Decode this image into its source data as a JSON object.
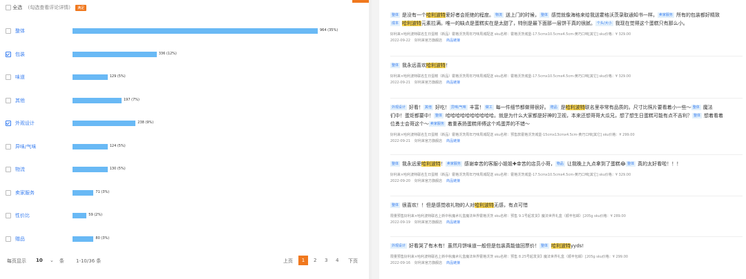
{
  "left": {
    "header": {
      "all_label": "全选",
      "hint": "(勾选查看评论详情)",
      "badge": "满足"
    },
    "rows": [
      {
        "label": "整体",
        "count_label": "964 (35%)",
        "share": 0.35,
        "checked": false
      },
      {
        "label": "包装",
        "count_label": "336 (12%)",
        "share": 0.12,
        "checked": true
      },
      {
        "label": "味道",
        "count_label": "129 (5%)",
        "share": 0.05,
        "checked": false
      },
      {
        "label": "其他",
        "count_label": "197 (7%)",
        "share": 0.07,
        "checked": false
      },
      {
        "label": "外观设计",
        "count_label": "238 (9%)",
        "share": 0.09,
        "checked": true
      },
      {
        "label": "异味/气味",
        "count_label": "124 (5%)",
        "share": 0.05,
        "checked": false
      },
      {
        "label": "物流",
        "count_label": "130 (5%)",
        "share": 0.05,
        "checked": false
      },
      {
        "label": "卖家服务",
        "count_label": "71 (3%)",
        "share": 0.03,
        "checked": false
      },
      {
        "label": "性价比",
        "count_label": "59 (2%)",
        "share": 0.02,
        "checked": false
      },
      {
        "label": "赠品",
        "count_label": "80 (3%)",
        "share": 0.03,
        "checked": false
      }
    ],
    "pager": {
      "per_page_label": "每页显示",
      "per_page": "10",
      "unit": "条",
      "range": "1-10/36 条",
      "prev": "上页",
      "pages": [
        "1",
        "2",
        "3",
        "4"
      ],
      "next": "下页"
    }
  },
  "reviews": [
    {
      "lines": [
        [
          {
            "t": "tag",
            "v": "整体"
          },
          {
            "t": "x",
            "v": "是没有一个"
          },
          {
            "t": "hl",
            "v": "哈利波特"
          },
          {
            "t": "x",
            "v": "爱好者会拒绝的程度。"
          },
          {
            "t": "tag",
            "v": "物流"
          },
          {
            "t": "x",
            "v": "送上门的时候，"
          },
          {
            "t": "tag",
            "v": "整体"
          },
          {
            "t": "x",
            "v": "感觉就像海格来给我送霍格沃茨录取通知书一样。"
          },
          {
            "t": "tag",
            "v": "卖家服务"
          },
          {
            "t": "x",
            "v": "所有的包装都好精致"
          }
        ],
        [
          {
            "t": "tag",
            "v": "成本"
          },
          {
            "t": "hl",
            "v": "哈利波特"
          },
          {
            "t": "x",
            "v": "元素拉满。唯一的缺点是蛋糕实在是太甜了，特别是最下面那一层饼干真的很腻。"
          },
          {
            "t": "tag",
            "v": "个头/大小"
          },
          {
            "t": "x",
            "v": "我现在觉得这个蛋糕只有那么小。"
          }
        ]
      ],
      "meta1": "好利来×哈利波特联名生日蛋糕（新品）霍格沃茨周年巧味周城配送   sku名称：霍格沃茨城堡-17.5cmx10.5cmx4.5cm-黄巧口味[其它]   sku价格：¥ 329.00",
      "date": "2022-09-22",
      "shop": "好利来官方旗舰店",
      "link": "商品链接"
    },
    {
      "lines": [
        [
          {
            "t": "tag",
            "v": "整体"
          },
          {
            "t": "x",
            "v": "我永远喜欢"
          },
          {
            "t": "hl",
            "v": "哈利波特"
          },
          {
            "t": "x",
            "v": "！"
          }
        ]
      ],
      "meta1": "好利来×哈利波特联名生日蛋糕（新品）霍格沃茨周年巧味周城配送   sku名称：霍格沃茨城堡-17.5cmx10.5cmx4.5cm-黄巧口味[其它]   sku价格：¥ 329.00",
      "date": "2022-09-21",
      "shop": "好利来官方旗舰店",
      "link": "商品链接"
    },
    {
      "lines": [
        [
          {
            "t": "tag",
            "v": "外观设计"
          },
          {
            "t": "x",
            "v": "好看！"
          },
          {
            "t": "tag",
            "v": "其他"
          },
          {
            "t": "x",
            "v": "好吃！"
          },
          {
            "t": "tag",
            "v": "异味/气味"
          },
          {
            "t": "x",
            "v": "丰富！"
          },
          {
            "t": "tag",
            "v": "做工"
          },
          {
            "t": "x",
            "v": "每一件细节都做得很好。"
          },
          {
            "t": "tag",
            "v": "赠品"
          },
          {
            "t": "x",
            "v": "是"
          },
          {
            "t": "hl",
            "v": "哈利波特"
          },
          {
            "t": "x",
            "v": "联名里非常有品质的。尺寸比照片要看着小一些～"
          },
          {
            "t": "tag",
            "v": "整体"
          },
          {
            "t": "x",
            "v": "魔法"
          }
        ],
        [
          {
            "t": "x",
            "v": "们中！蛋炬都要中！"
          },
          {
            "t": "tag",
            "v": "整体"
          },
          {
            "t": "x",
            "v": "哈哈哈哈哈哈哈哈哈哈。就是为什么大家都是好神的卫视，本来还想哥哥大瓜兄，想了想生日蛋糕可能有点不吉利？"
          },
          {
            "t": "tag",
            "v": "整体"
          },
          {
            "t": "x",
            "v": "想着看着"
          }
        ],
        [
          {
            "t": "x",
            "v": "位勇士会哥这个～"
          },
          {
            "t": "tag",
            "v": "卖家服务"
          },
          {
            "t": "x",
            "v": "着重表扬蛋糕师傅这个鸡蛋弄的不错～"
          }
        ]
      ],
      "meta1": "好利来×哈利波特联名生日蛋糕（新品）霍格沃茨周年巧味周城配送   sku名称：预售款霍格沃茨城堡-15cmx13cmx4.5cm-黄巧口味[其它]   sku价格：¥ 299.00",
      "date": "2022-09-21",
      "shop": "好利来官方旗舰店",
      "link": "商品链接"
    },
    {
      "lines": [
        [
          {
            "t": "tag",
            "v": "整体"
          },
          {
            "t": "x",
            "v": "我永远爱"
          },
          {
            "t": "hl",
            "v": "哈利波特"
          },
          {
            "t": "x",
            "v": "！"
          },
          {
            "t": "tag",
            "v": "卖家服务"
          },
          {
            "t": "x",
            "v": "感谢幸苦的客服小姐姐✚幸苦的店员小哥，"
          },
          {
            "t": "tag",
            "v": "物品"
          },
          {
            "t": "x",
            "v": "让我晚上九点拿到了蛋糕😂"
          },
          {
            "t": "tag",
            "v": "整体"
          },
          {
            "t": "x",
            "v": "真的太好看啦！！！"
          }
        ]
      ],
      "meta1": "好利来×哈利波特联名生日蛋糕（新品）霍格沃茨周年巧味周城配送   sku名称：霍格沃茨城堡-17.5cmx10.5cmx4.5cm-黄巧口味[其它]   sku价格：¥ 329.00",
      "date": "2022-09-20",
      "shop": "好利来官方旗舰店",
      "link": "商品链接"
    },
    {
      "lines": [
        [
          {
            "t": "tag",
            "v": "整体"
          },
          {
            "t": "x",
            "v": "很喜欢！！但是感觉收礼物的人对"
          },
          {
            "t": "hl",
            "v": "哈利波特"
          },
          {
            "t": "x",
            "v": "无感，有点可惜"
          }
        ]
      ],
      "meta1": "限量预售好利来×哈利波特联名上新中秋魔术礼盒魔法世界霍格沃茨   sku名称：预售 9.1号起发货】魔法世界礼盒（顺丰包邮）[205g   sku价格：¥ 289.00",
      "date": "2022-09-19",
      "shop": "好利来官方旗舰店",
      "link": "商品链接"
    },
    {
      "lines": [
        [
          {
            "t": "tag",
            "v": "外观设计"
          },
          {
            "t": "x",
            "v": "好看哭了有木有！虽然月饼味道一般但是包装真能值回票价！"
          },
          {
            "t": "tag",
            "v": "整体"
          },
          {
            "t": "hl",
            "v": "哈利波特"
          },
          {
            "t": "x",
            "v": "yyds!"
          }
        ]
      ],
      "meta1": "限量预售好利来×哈利波特联名上新中秋魔术礼盒魔法世界霍格沃茨   sku名称：预售 8.25号起发货】魔法世界礼盒（顺丰包邮）[205g   sku价格：¥ 299.00",
      "date": "2022-09-16",
      "shop": "好利来官方旗舰店",
      "link": "商品链接"
    }
  ],
  "colors": {
    "accent": "#f0781e",
    "bar": "#69b9f5",
    "link": "#3a7ff0",
    "highlight": "#fbd54a"
  }
}
